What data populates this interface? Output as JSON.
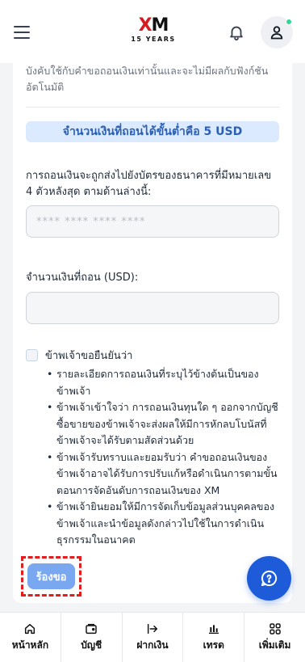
{
  "header": {
    "logo_text": "XM",
    "logo_subtitle": "15 YEARS",
    "menu_icon": "hamburger-icon",
    "bell_icon": "bell-icon",
    "profile_icon": "user-icon"
  },
  "form": {
    "top_note": "บังคับใช้กับคำขอถอนเงินเท่านั้นและจะไม่มีผลกับฟังก์ชันอัตโนมัติ",
    "min_withdrawal": "จำนวนเงินที่ถอนได้ขั้นต่ำคือ 5 USD",
    "card_label": "การถอนเงินจะถูกส่งไปยังบัตรของธนาคารที่มีหมายเลข 4 ตัวหลังสุด ตามด้านล่างนี้:",
    "card_placeholder": "**** **** **** ****",
    "card_value": "",
    "amount_label": "จำนวนเงินที่ถอน (USD):",
    "amount_placeholder": "",
    "amount_value": "",
    "agree_title": "ข้าพเจ้าขอยืนยันว่า",
    "agree_checked": false,
    "terms": [
      "รายละเอียดการถอนเงินที่ระบุไว้ข้างต้นเป็นของข้าพเจ้า",
      "ข้าพเจ้าเข้าใจว่า การถอนเงินทุนใด ๆ ออกจากบัญชีซื้อขายของข้าพเจ้าจะส่งผลให้มีการหักลบโบนัสที่ข้าพเจ้าจะได้รับตามสัดส่วนด้วย",
      "ข้าพเจ้ารับทราบและยอมรับว่า คำขอถอนเงินของข้าพเจ้าอาจได้รับการปรับแก้หรือดำเนินการตามขั้นตอนการจัดอันดับการถอนเงินของ XM",
      "ข้าพเจ้ายินยอมให้มีการจัดเก็บข้อมูลส่วนบุคคลของข้าพเจ้าและนำข้อมูลดังกล่าวไปใช้ในการดำเนินธุรกรรมในอนาคต"
    ],
    "submit_label": "ร้องขอ"
  },
  "chat": {
    "icon": "chat-help-icon"
  },
  "bottom_nav": [
    {
      "label": "หน้าหลัก",
      "icon": "home-icon"
    },
    {
      "label": "บัญชี",
      "icon": "wallet-icon"
    },
    {
      "label": "ฝากเงิน",
      "icon": "deposit-arrow-icon"
    },
    {
      "label": "เทรด",
      "icon": "chart-bars-icon"
    },
    {
      "label": "เพิ่มเติม",
      "icon": "grid-icon"
    }
  ],
  "colors": {
    "accent": "#1e5bd8",
    "banner_bg": "#dbeafe",
    "banner_text": "#2b5fb3",
    "submit_bg": "#7aa8f0",
    "highlight_border": "#e11d1d",
    "online": "#34d399"
  }
}
